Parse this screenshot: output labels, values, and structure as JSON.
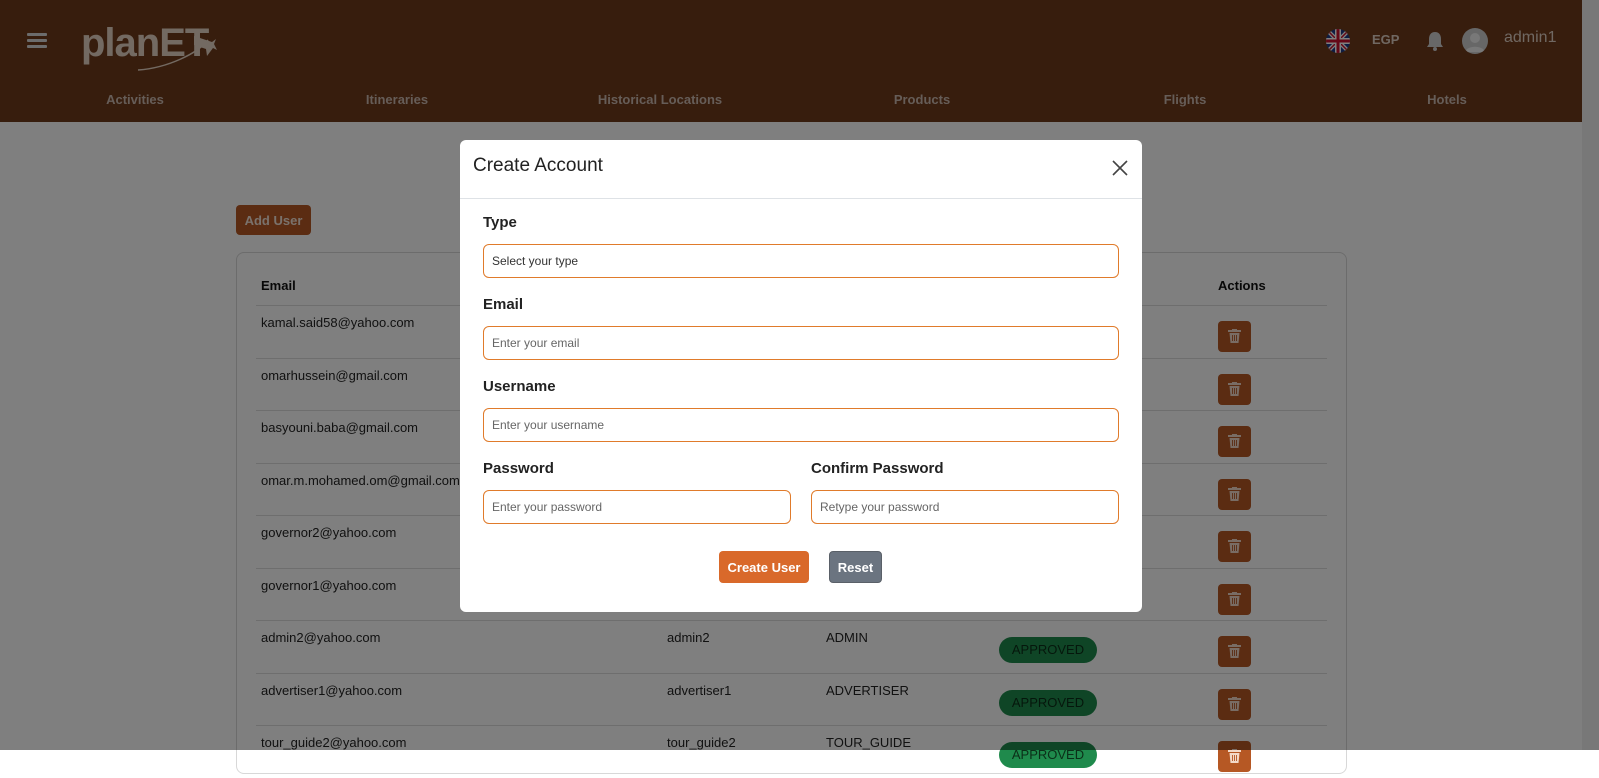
{
  "app": {
    "username": "admin1",
    "currency": "EGP"
  },
  "logo": {
    "text": "planET"
  },
  "nav": [
    {
      "label": "Activities"
    },
    {
      "label": "Itineraries"
    },
    {
      "label": "Historical Locations"
    },
    {
      "label": "Products"
    },
    {
      "label": "Flights"
    },
    {
      "label": "Hotels"
    }
  ],
  "page": {
    "add_user_label": "Add User",
    "columns": {
      "email": "Email",
      "actions": "Actions"
    },
    "rows": [
      {
        "email": "kamal.said58@yahoo.com",
        "username": "",
        "type": "",
        "status": ""
      },
      {
        "email": "omarhussein@gmail.com",
        "username": "",
        "type": "",
        "status": ""
      },
      {
        "email": "basyouni.baba@gmail.com",
        "username": "",
        "type": "",
        "status": ""
      },
      {
        "email": "omar.m.mohamed.om@gmail.com",
        "username": "",
        "type": "",
        "status": ""
      },
      {
        "email": "governor2@yahoo.com",
        "username": "",
        "type": "",
        "status": ""
      },
      {
        "email": "governor1@yahoo.com",
        "username": "",
        "type": "",
        "status": ""
      },
      {
        "email": "admin2@yahoo.com",
        "username": "admin2",
        "type": "ADMIN",
        "status": "APPROVED"
      },
      {
        "email": "advertiser1@yahoo.com",
        "username": "advertiser1",
        "type": "ADVERTISER",
        "status": "APPROVED"
      },
      {
        "email": "tour_guide2@yahoo.com",
        "username": "tour_guide2",
        "type": "TOUR_GUIDE",
        "status": "APPROVED"
      }
    ]
  },
  "modal": {
    "title": "Create Account",
    "type": {
      "label": "Type",
      "value": "Select your type"
    },
    "email": {
      "label": "Email",
      "placeholder": "Enter your email"
    },
    "username": {
      "label": "Username",
      "placeholder": "Enter your username"
    },
    "password": {
      "label": "Password",
      "placeholder": "Enter your password"
    },
    "confirm_password": {
      "label": "Confirm Password",
      "placeholder": "Retype your password"
    },
    "create_label": "Create User",
    "reset_label": "Reset"
  },
  "icons": {
    "menu": "hamburger-menu-icon",
    "flag": "uk-flag-icon",
    "notifications": "bell-icon",
    "avatar": "user-avatar-icon",
    "delete": "trash-icon",
    "close": "close-icon"
  },
  "colors": {
    "header": "#6f3a1b",
    "accent": "#d9692a",
    "approved": "#1f8a4c",
    "reset": "#6b7480"
  }
}
